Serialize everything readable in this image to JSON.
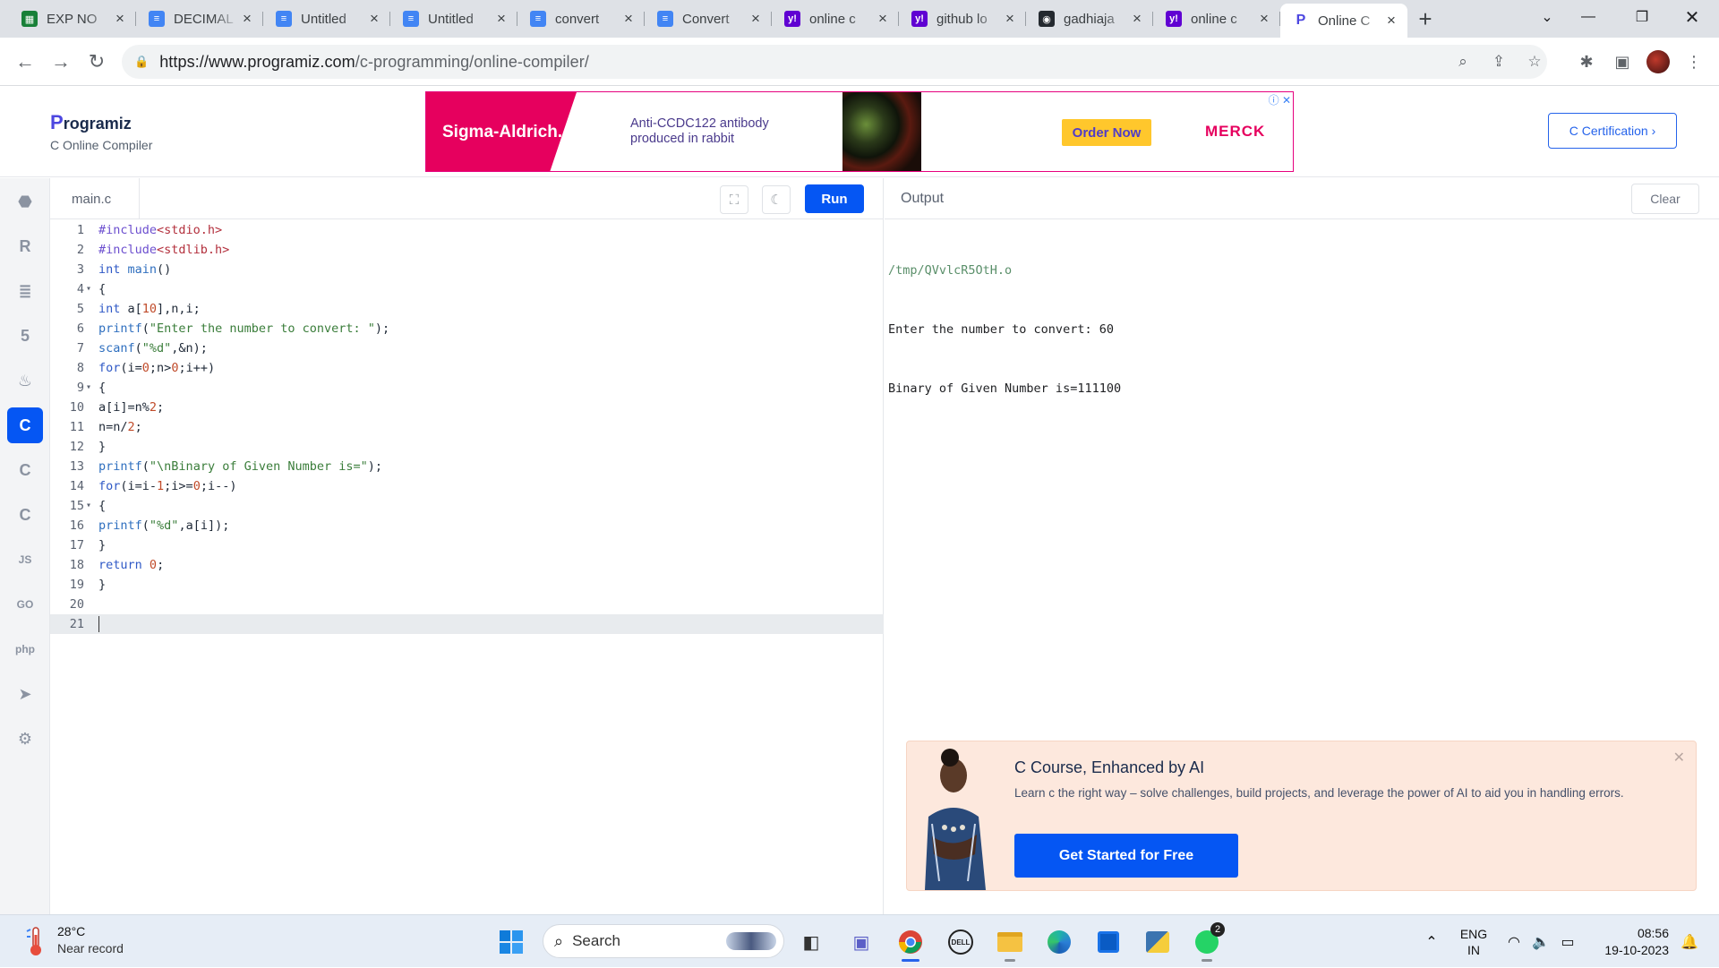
{
  "browser": {
    "tabs": [
      {
        "label": "EXP NO",
        "icon": "sheets-icon",
        "color": "#188038",
        "glyph": "▦"
      },
      {
        "label": "DECIMAL",
        "icon": "docs-icon",
        "color": "#4285f4",
        "glyph": "≡"
      },
      {
        "label": "Untitled",
        "icon": "docs-icon",
        "color": "#4285f4",
        "glyph": "≡"
      },
      {
        "label": "Untitled",
        "icon": "docs-icon",
        "color": "#4285f4",
        "glyph": "≡"
      },
      {
        "label": "convert",
        "icon": "docs-icon",
        "color": "#4285f4",
        "glyph": "≡"
      },
      {
        "label": "Convert",
        "icon": "docs-icon",
        "color": "#4285f4",
        "glyph": "≡"
      },
      {
        "label": "online c",
        "icon": "yahoo-icon",
        "color": "#6001d2",
        "glyph": "y!"
      },
      {
        "label": "github lo",
        "icon": "yahoo-icon",
        "color": "#6001d2",
        "glyph": "y!"
      },
      {
        "label": "gadhiaja",
        "icon": "github-icon",
        "color": "#24292f",
        "glyph": "◉"
      },
      {
        "label": "online c",
        "icon": "yahoo-icon",
        "color": "#6001d2",
        "glyph": "y!"
      },
      {
        "label": "Online C",
        "icon": "programiz-icon",
        "color": "#4d47e0",
        "glyph": "P",
        "active": true
      }
    ],
    "url_host": "https://www.programiz.com",
    "url_path": "/c-programming/online-compiler/"
  },
  "site": {
    "logo": "rogramiz",
    "logo_p": "P",
    "subtitle": "C Online Compiler",
    "certification": "C Certification ›"
  },
  "ad": {
    "brand": "Sigma-Aldrich.",
    "line1": "Anti-CCDC122 antibody",
    "line2": "produced in rabbit",
    "cta": "Order Now",
    "merck": "MERCK"
  },
  "editor": {
    "filename": "main.c",
    "run_label": "Run",
    "lines": [
      {
        "n": "1",
        "fold": false
      },
      {
        "n": "2",
        "fold": false
      },
      {
        "n": "3",
        "fold": false
      },
      {
        "n": "4",
        "fold": true
      },
      {
        "n": "5",
        "fold": false
      },
      {
        "n": "6",
        "fold": false
      },
      {
        "n": "7",
        "fold": false
      },
      {
        "n": "8",
        "fold": false
      },
      {
        "n": "9",
        "fold": true
      },
      {
        "n": "10",
        "fold": false
      },
      {
        "n": "11",
        "fold": false
      },
      {
        "n": "12",
        "fold": false
      },
      {
        "n": "13",
        "fold": false
      },
      {
        "n": "14",
        "fold": false
      },
      {
        "n": "15",
        "fold": true
      },
      {
        "n": "16",
        "fold": false
      },
      {
        "n": "17",
        "fold": false
      },
      {
        "n": "18",
        "fold": false
      },
      {
        "n": "19",
        "fold": false
      },
      {
        "n": "20",
        "fold": false
      },
      {
        "n": "21",
        "fold": false
      }
    ],
    "code": [
      "#include<stdio.h>",
      "#include<stdlib.h>",
      "int main()",
      "{",
      "int a[10],n,i;",
      "printf(\"Enter the number to convert: \");",
      "scanf(\"%d\",&n);",
      "for(i=0;n>0;i++)",
      "{",
      "a[i]=n%2;",
      "n=n/2;",
      "}",
      "printf(\"\\nBinary of Given Number is=\");",
      "for(i=i-1;i>=0;i--)",
      "{",
      "printf(\"%d\",a[i]);",
      "}",
      "return 0;",
      "}",
      "",
      ""
    ]
  },
  "output": {
    "title": "Output",
    "clear_label": "Clear",
    "path": "/tmp/QVvlcR5OtH.o",
    "line1": "Enter the number to convert: 60",
    "line2": "Binary of Given Number is=111100"
  },
  "promo": {
    "title": "C Course, Enhanced by AI",
    "desc": "Learn c the right way – solve challenges, build projects, and leverage the power of AI to aid you in handling errors.",
    "cta": "Get Started for Free"
  },
  "rail": [
    "python-icon",
    "r-icon",
    "sql-icon",
    "html-icon",
    "java-icon",
    "c-icon",
    "cpp-icon",
    "csharp-icon",
    "js-icon",
    "go-icon",
    "php-icon",
    "swift-icon",
    "rust-icon"
  ],
  "taskbar": {
    "temp": "28°C",
    "weather": "Near record",
    "search": "Search",
    "lang1": "ENG",
    "lang2": "IN",
    "time": "08:56",
    "date": "19-10-2023",
    "whatsapp_badge": "2"
  },
  "colors": {
    "accent": "#0556f3",
    "brand": "#4d47e0"
  }
}
